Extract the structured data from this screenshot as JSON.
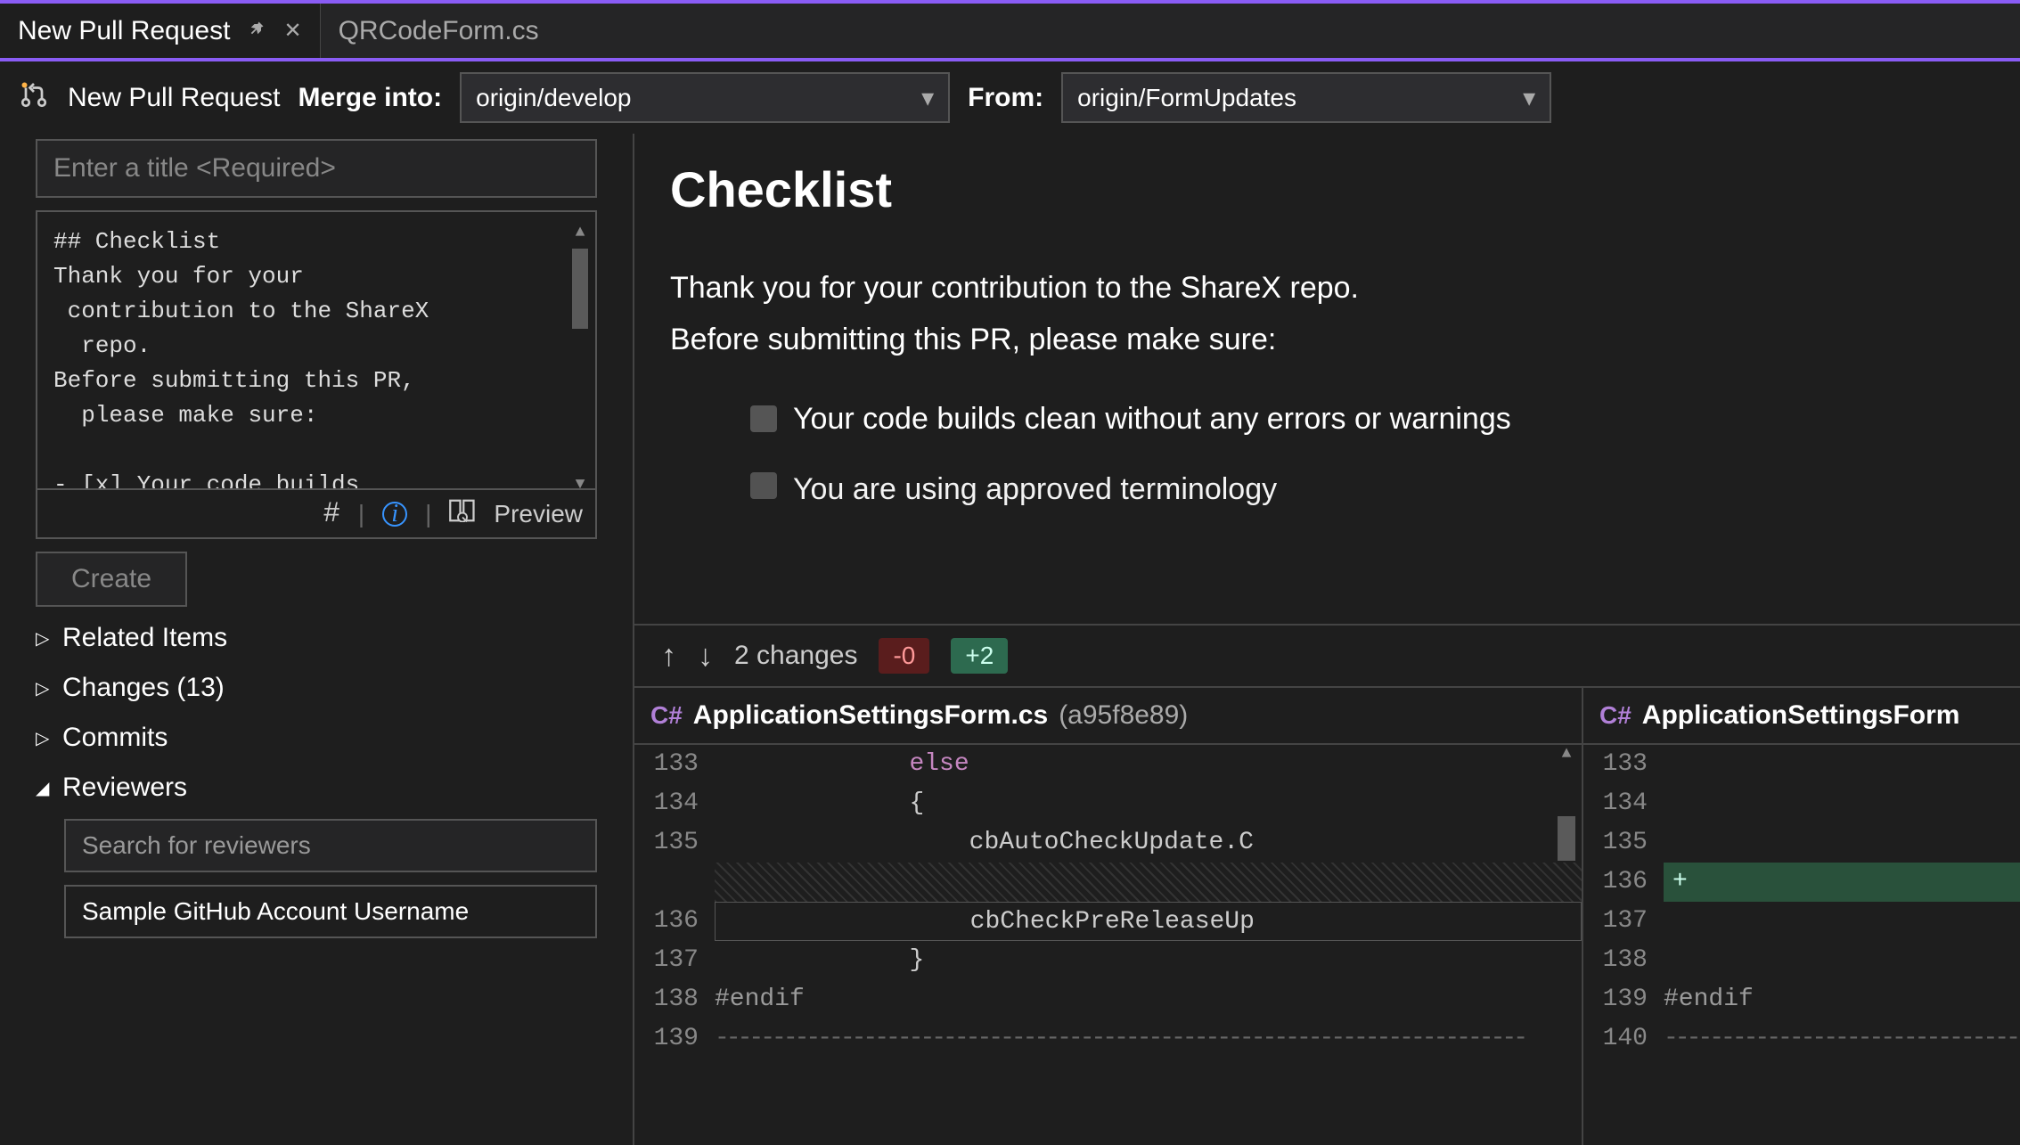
{
  "tabs": {
    "active": {
      "title": "New Pull Request"
    },
    "inactive": {
      "title": "QRCodeForm.cs"
    }
  },
  "toolbar": {
    "label": "New Pull Request",
    "mergeInto": "Merge into:",
    "mergeBranch": "origin/develop",
    "from": "From:",
    "fromBranch": "origin/FormUpdates"
  },
  "form": {
    "titlePlaceholder": "Enter a title <Required>",
    "description": "## Checklist\nThank you for your\n contribution to the ShareX\n  repo.\nBefore submitting this PR,\n  please make sure:\n\n- [x] Your code builds",
    "previewBtn": "Preview",
    "createBtn": "Create"
  },
  "tree": {
    "related": "Related Items",
    "changes": "Changes (13)",
    "commits": "Commits",
    "reviewers": "Reviewers",
    "reviewerSearch": "Search for reviewers",
    "reviewerItem": "Sample GitHub Account Username"
  },
  "preview": {
    "heading": "Checklist",
    "p1": "Thank you for your contribution to the ShareX repo.",
    "p2": "Before submitting this PR, please make sure:",
    "check1": "Your code builds clean without any errors or warnings",
    "check2": "You are using approved terminology"
  },
  "diffbar": {
    "changes": "2 changes",
    "minus": "-0",
    "plus": "+2"
  },
  "diff": {
    "csBadge": "C#",
    "filename": "ApplicationSettingsForm.cs",
    "hash": "(a95f8e89)",
    "filename2": "ApplicationSettingsForm",
    "left": {
      "lines": [
        133,
        134,
        135,
        136,
        137,
        138,
        139
      ],
      "l133": "else",
      "l134": "{",
      "l135": "cbAutoCheckUpdate.C",
      "l136": "cbCheckPreReleaseUp",
      "l137": "}",
      "l138": "#endif"
    },
    "right": {
      "lines": [
        133,
        134,
        135,
        136,
        137,
        138,
        139,
        140
      ],
      "l139": "#endif"
    }
  }
}
